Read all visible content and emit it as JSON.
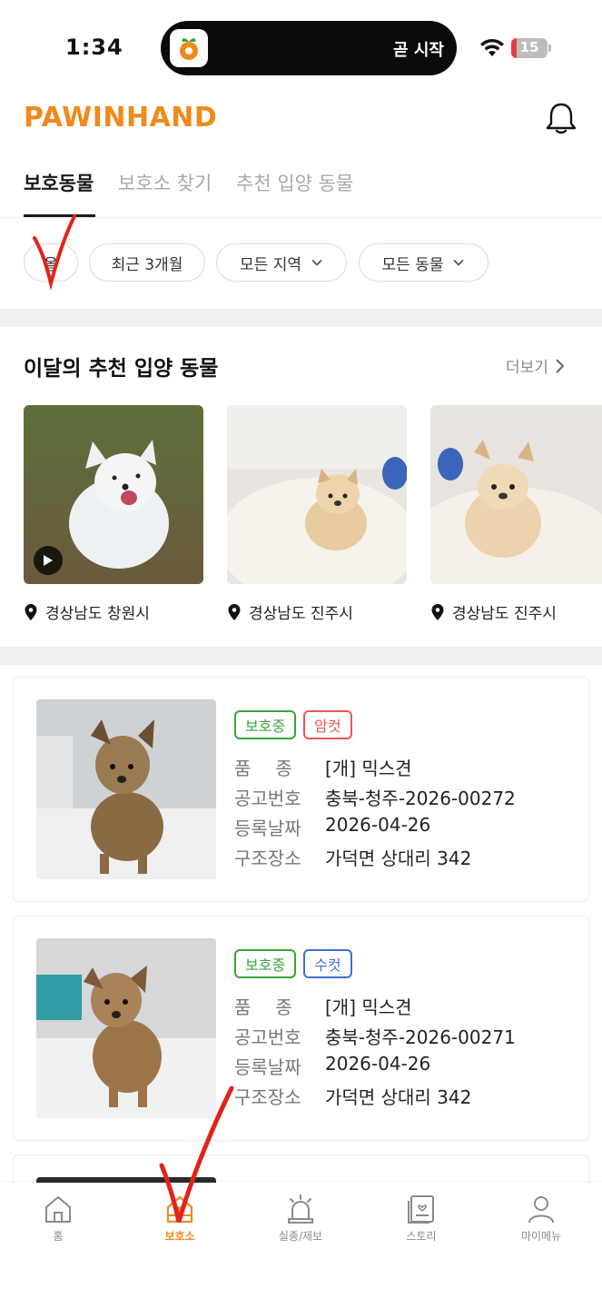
{
  "status_bar": {
    "time": "1:34",
    "live_activity_text": "곧 시작",
    "battery_level": "15",
    "battery_color": "#ea3b3b"
  },
  "header": {
    "logo": "PAWINHAND",
    "logo_color": "#f08a1c",
    "bell_icon": "bell-icon"
  },
  "tabs": [
    {
      "label": "보호동물",
      "active": true
    },
    {
      "label": "보호소 찾기",
      "active": false
    },
    {
      "label": "추천 입양 동물",
      "active": false
    }
  ],
  "filters": [
    {
      "label": "올",
      "dropdown": false
    },
    {
      "label": "최근 3개월",
      "dropdown": false
    },
    {
      "label": "모든 지역",
      "dropdown": true
    },
    {
      "label": "모든 동물",
      "dropdown": true
    }
  ],
  "recommended": {
    "title": "이달의 추천 입양 동물",
    "more_label": "더보기",
    "items": [
      {
        "location": "경상남도 창원시",
        "has_video": true
      },
      {
        "location": "경상남도 진주시",
        "has_video": false
      },
      {
        "location": "경상남도 진주시",
        "has_video": false
      }
    ]
  },
  "listings": [
    {
      "status_badge": "보호중",
      "sex_badge": "암컷",
      "breed_label": "품종",
      "breed": "[개] 믹스견",
      "notice_label": "공고번호",
      "notice_no": "충북-청주-2026-00272",
      "date_label": "등록날짜",
      "date": "2026-04-26",
      "place_label": "구조장소",
      "place": "가덕면 상대리 342"
    },
    {
      "status_badge": "보호중",
      "sex_badge": "수컷",
      "breed_label": "품종",
      "breed": "[개] 믹스견",
      "notice_label": "공고번호",
      "notice_no": "충북-청주-2026-00271",
      "date_label": "등록날짜",
      "date": "2026-04-26",
      "place_label": "구조장소",
      "place": "가덕면 상대리 342"
    }
  ],
  "colors": {
    "status_green": "#3aa43a",
    "female_red": "#e8574f",
    "male_blue": "#3d6fd6",
    "accent": "#f08a1c"
  },
  "bottom_nav": [
    {
      "label": "홈",
      "icon": "home-icon",
      "active": false
    },
    {
      "label": "보호소",
      "icon": "shelter-icon",
      "active": true
    },
    {
      "label": "실종/제보",
      "icon": "siren-icon",
      "active": false
    },
    {
      "label": "스토리",
      "icon": "story-icon",
      "active": false
    },
    {
      "label": "마이메뉴",
      "icon": "person-icon",
      "active": false
    }
  ]
}
